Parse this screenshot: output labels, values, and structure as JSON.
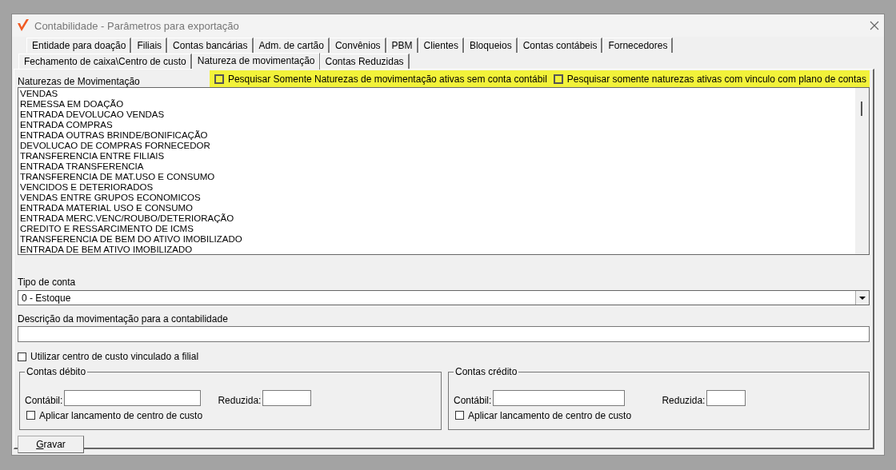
{
  "window": {
    "title": "Contabilidade - Parâmetros para exportação"
  },
  "tab_rows": [
    {
      "tabs": [
        {
          "label": "Entidade para doação",
          "selected": false
        },
        {
          "label": "Filiais",
          "selected": false
        },
        {
          "label": "Contas bancárias",
          "selected": false
        },
        {
          "label": "Adm. de cartão",
          "selected": false
        },
        {
          "label": "Convênios",
          "selected": false
        },
        {
          "label": "PBM",
          "selected": false
        },
        {
          "label": "Clientes",
          "selected": false
        },
        {
          "label": "Bloqueios",
          "selected": false
        },
        {
          "label": "Contas contábeis",
          "selected": false
        },
        {
          "label": "Fornecedores",
          "selected": false
        }
      ]
    },
    {
      "tabs": [
        {
          "label": "Fechamento de caixa\\Centro de custo",
          "selected": false
        },
        {
          "label": "Natureza de movimentação",
          "selected": true
        },
        {
          "label": "Contas Reduzidas",
          "selected": false
        }
      ]
    }
  ],
  "naturezas": {
    "label": "Naturezas de Movimentação",
    "items": [
      "VENDAS",
      "REMESSA EM DOAÇÃO",
      "ENTRADA DEVOLUCAO VENDAS",
      "ENTRADA COMPRAS",
      "ENTRADA OUTRAS BRINDE/BONIFICAÇÃO",
      "DEVOLUCAO DE COMPRAS FORNECEDOR",
      "TRANSFERENCIA ENTRE FILIAIS",
      "ENTRADA TRANSFERENCIA",
      "TRANSFERENCIA DE MAT.USO E CONSUMO",
      "VENCIDOS E DETERIORADOS",
      "VENDAS ENTRE GRUPOS ECONOMICOS",
      "ENTRADA MATERIAL USO E CONSUMO",
      "ENTRADA MERC.VENC/ROUBO/DETERIORAÇÃO",
      "CREDITO E RESSARCIMENTO DE ICMS",
      "TRANSFERENCIA DE BEM DO ATIVO IMOBILIZADO",
      "ENTRADA DE BEM ATIVO IMOBILIZADO"
    ]
  },
  "filters": [
    {
      "label": "Pesquisar Somente Naturezas de movimentação ativas sem conta contábil",
      "checked": false
    },
    {
      "label": "Pesquisar somente naturezas ativas com vinculo com plano de contas",
      "checked": false
    }
  ],
  "tipo_conta": {
    "label": "Tipo de conta",
    "value": "0 - Estoque"
  },
  "descricao": {
    "label": "Descrição da movimentação para a contabilidade"
  },
  "centro_filial": {
    "label": "Utilizar centro de custo vinculado a filial",
    "checked": false
  },
  "groups": [
    {
      "title": "Contas débito",
      "contabil_label": "Contábil:",
      "reduzida_label": "Reduzida:",
      "check": {
        "label": "Aplicar lancamento de centro de custo",
        "checked": false
      }
    },
    {
      "title": "Contas crédito",
      "contabil_label": "Contábil:",
      "reduzida_label": "Reduzida:",
      "check": {
        "label": "Aplicar lancamento de centro de custo",
        "checked": false
      }
    }
  ],
  "save_button": "Gravar"
}
